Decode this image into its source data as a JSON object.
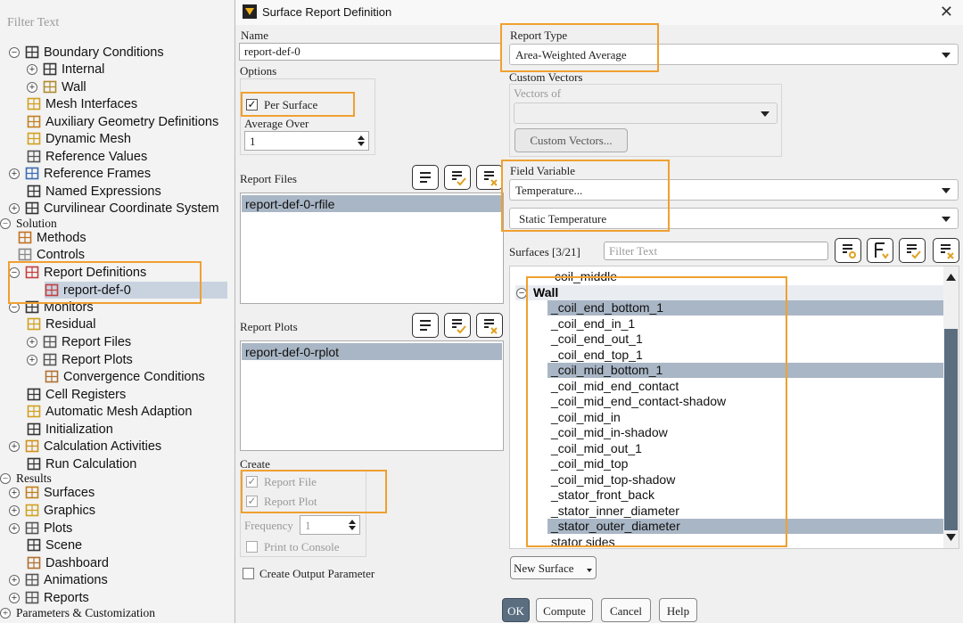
{
  "tree": {
    "filter_placeholder": "Filter Text",
    "items": [
      {
        "label": "Boundary Conditions",
        "exp": "−"
      },
      {
        "label": "Internal",
        "exp": "+"
      },
      {
        "label": "Wall",
        "exp": "+"
      },
      {
        "label": "Mesh Interfaces",
        "exp": ""
      },
      {
        "label": "Auxiliary Geometry Definitions",
        "exp": ""
      },
      {
        "label": "Dynamic Mesh",
        "exp": ""
      },
      {
        "label": "Reference Values",
        "exp": ""
      },
      {
        "label": "Reference Frames",
        "exp": "+"
      },
      {
        "label": "Named Expressions",
        "exp": ""
      },
      {
        "label": "Curvilinear Coordinate System",
        "exp": "+"
      },
      {
        "label": "Solution",
        "exp": "−"
      },
      {
        "label": "Methods",
        "exp": ""
      },
      {
        "label": "Controls",
        "exp": ""
      },
      {
        "label": "Report Definitions",
        "exp": "−"
      },
      {
        "label": "report-def-0",
        "exp": ""
      },
      {
        "label": "Monitors",
        "exp": "−"
      },
      {
        "label": "Residual",
        "exp": ""
      },
      {
        "label": "Report Files",
        "exp": "+"
      },
      {
        "label": "Report Plots",
        "exp": "+"
      },
      {
        "label": "Convergence Conditions",
        "exp": ""
      },
      {
        "label": "Cell Registers",
        "exp": ""
      },
      {
        "label": "Automatic Mesh Adaption",
        "exp": ""
      },
      {
        "label": "Initialization",
        "exp": ""
      },
      {
        "label": "Calculation Activities",
        "exp": "+"
      },
      {
        "label": "Run Calculation",
        "exp": ""
      },
      {
        "label": "Results",
        "exp": "−"
      },
      {
        "label": "Surfaces",
        "exp": "+"
      },
      {
        "label": "Graphics",
        "exp": "+"
      },
      {
        "label": "Plots",
        "exp": "+"
      },
      {
        "label": "Scene",
        "exp": ""
      },
      {
        "label": "Dashboard",
        "exp": ""
      },
      {
        "label": "Animations",
        "exp": "+"
      },
      {
        "label": "Reports",
        "exp": "+"
      },
      {
        "label": "Parameters & Customization",
        "exp": "+"
      }
    ]
  },
  "dialog": {
    "title": "Surface Report Definition",
    "name_label": "Name",
    "name_value": "report-def-0",
    "options_label": "Options",
    "per_surface_label": "Per Surface",
    "per_surface_checked": true,
    "average_over_label": "Average Over",
    "average_over_value": "1",
    "report_files_label": "Report Files",
    "report_files_items": [
      "report-def-0-rfile"
    ],
    "report_plots_label": "Report Plots",
    "report_plots_items": [
      "report-def-0-rplot"
    ],
    "create_label": "Create",
    "report_file_label": "Report File",
    "report_plot_label": "Report Plot",
    "frequency_label": "Frequency",
    "frequency_value": "1",
    "print_to_console_label": "Print to Console",
    "create_output_param_label": "Create Output Parameter",
    "report_type_label": "Report Type",
    "report_type_value": "Area-Weighted Average",
    "custom_vectors_label": "Custom Vectors",
    "vectors_of_label": "Vectors of",
    "custom_vectors_button": "Custom Vectors...",
    "field_variable_label": "Field Variable",
    "field_variable_value": "Temperature...",
    "field_variable_sub": "Static Temperature",
    "surfaces_label": "Surfaces [3/21]",
    "surfaces_filter_placeholder": "Filter Text",
    "surfaces_partial": "coil_middle",
    "surfaces_group": "Wall",
    "surfaces_items": [
      {
        "name": "_coil_end_bottom_1",
        "selected": true
      },
      {
        "name": "_coil_end_in_1",
        "selected": false
      },
      {
        "name": "_coil_end_out_1",
        "selected": false
      },
      {
        "name": "_coil_end_top_1",
        "selected": false
      },
      {
        "name": "_coil_mid_bottom_1",
        "selected": true
      },
      {
        "name": "_coil_mid_end_contact",
        "selected": false
      },
      {
        "name": "_coil_mid_end_contact-shadow",
        "selected": false
      },
      {
        "name": "_coil_mid_in",
        "selected": false
      },
      {
        "name": "_coil_mid_in-shadow",
        "selected": false
      },
      {
        "name": "_coil_mid_out_1",
        "selected": false
      },
      {
        "name": "_coil_mid_top",
        "selected": false
      },
      {
        "name": "_coil_mid_top-shadow",
        "selected": false
      },
      {
        "name": "_stator_front_back",
        "selected": false
      },
      {
        "name": "_stator_inner_diameter",
        "selected": false
      },
      {
        "name": "_stator_outer_diameter",
        "selected": true
      },
      {
        "name": "stator sides",
        "selected": false
      }
    ],
    "new_surface_button": "New Surface",
    "ok_button": "OK",
    "compute_button": "Compute",
    "cancel_button": "Cancel",
    "help_button": "Help"
  },
  "colors": {
    "highlight": "#f0a030",
    "selection": "#a9b6c5",
    "ok_button": "#5a6e80"
  }
}
